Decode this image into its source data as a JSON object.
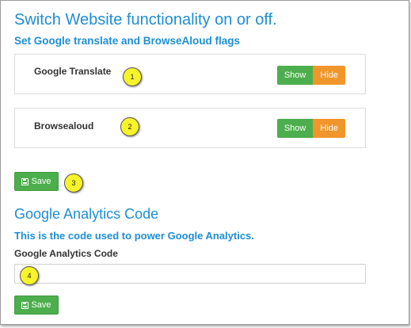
{
  "page": {
    "title": "Switch Website functionality on or off.",
    "subtitle": "Set Google translate and BrowseAloud flags"
  },
  "flags": [
    {
      "label": "Google Translate",
      "show_label": "Show",
      "hide_label": "Hide",
      "marker": "1"
    },
    {
      "label": "Browsealoud",
      "show_label": "Show",
      "hide_label": "Hide",
      "marker": "2"
    }
  ],
  "flags_save": {
    "label": "Save",
    "marker": "3"
  },
  "analytics": {
    "title": "Google Analytics Code",
    "description": "This is the code used to power Google Analytics.",
    "field_label": "Google Analytics Code",
    "field_value": "",
    "field_placeholder": "",
    "marker": "4",
    "save_label": "Save"
  },
  "colors": {
    "heading": "#1d8ed4",
    "show_button": "#4cae4c",
    "hide_button": "#f0962a",
    "save_button": "#4cae4c",
    "marker": "#f7f32a"
  },
  "icons": {
    "save": "floppy-disk-icon"
  }
}
